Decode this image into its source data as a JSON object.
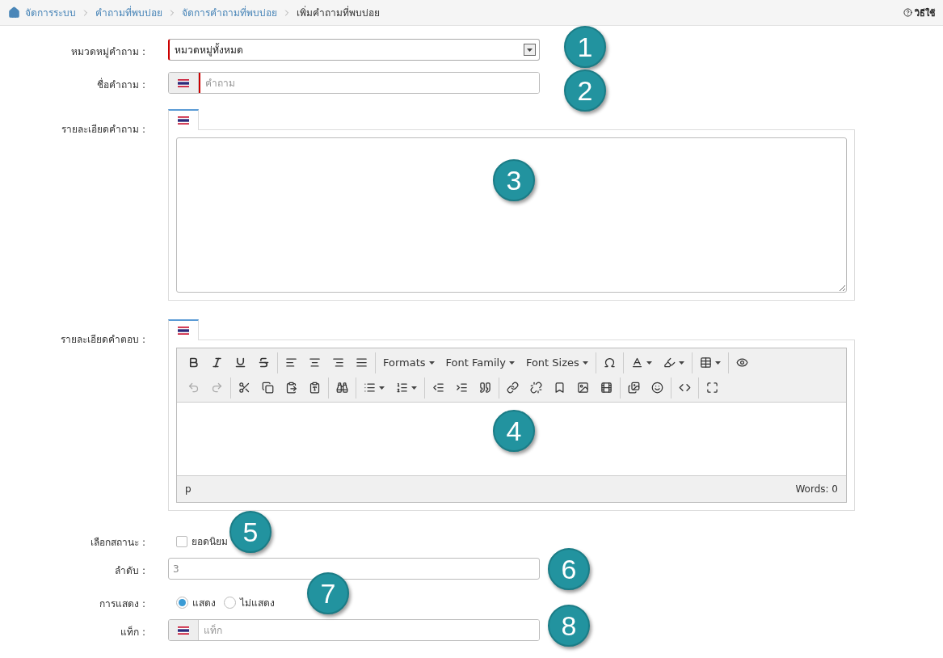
{
  "breadcrumb": [
    {
      "label": "จัดการระบบ",
      "current": false
    },
    {
      "label": "คำถามที่พบบ่อย",
      "current": false
    },
    {
      "label": "จัดการคำถามที่พบบ่อย",
      "current": false
    },
    {
      "label": "เพิ่มคำถามที่พบบ่อย",
      "current": true
    }
  ],
  "help": "วิธีใช้",
  "fields": [
    {
      "kind": "select",
      "label": "หมวดหมู่คำถาม :",
      "value": "หมวดหมู่ทั้งหมด",
      "required": true,
      "callout": "1"
    },
    {
      "kind": "flag-input",
      "label": "ชื่อคำถาม :",
      "placeholder": "คำถาม",
      "required": true,
      "callout": "2"
    },
    {
      "kind": "textarea",
      "label": "รายละเอียดคำถาม :",
      "callout": "3"
    },
    {
      "kind": "editor",
      "label": "รายละเอียดคำตอบ :",
      "callout": "4",
      "path": "p",
      "words": "Words: 0"
    },
    {
      "kind": "checkbox",
      "label": "เลือกสถานะ :",
      "option": "ยอดนิยม",
      "checked": false,
      "callout": "5"
    },
    {
      "kind": "input",
      "label": "ลำดับ :",
      "value": "3",
      "callout": "6"
    },
    {
      "kind": "radio",
      "label": "การแสดง :",
      "options": [
        {
          "label": "แสดง",
          "selected": true
        },
        {
          "label": "ไม่แสดง",
          "selected": false
        }
      ],
      "callout": "7"
    },
    {
      "kind": "flag-input",
      "label": "แท็ก :",
      "placeholder": "แท็ก",
      "required": false,
      "callout": "8"
    }
  ],
  "toolbar": [
    [
      [
        {
          "kind": "icon",
          "disabled": false
        },
        {
          "kind": "icon",
          "disabled": false
        },
        {
          "kind": "icon",
          "disabled": false
        },
        {
          "kind": "icon",
          "disabled": false
        }
      ],
      [
        {
          "kind": "icon",
          "disabled": false
        },
        {
          "kind": "icon",
          "disabled": false
        },
        {
          "kind": "icon",
          "disabled": false
        },
        {
          "kind": "icon",
          "disabled": false
        }
      ],
      [
        {
          "kind": "menu",
          "label": "Formats"
        },
        {
          "kind": "menu",
          "label": "Font Family"
        },
        {
          "kind": "menu",
          "label": "Font Sizes"
        }
      ],
      [
        {
          "kind": "icon",
          "disabled": false
        }
      ],
      [
        {
          "kind": "split",
          "disabled": false
        },
        {
          "kind": "split",
          "disabled": false
        }
      ],
      [
        {
          "kind": "split",
          "disabled": false
        }
      ],
      [
        {
          "kind": "icon",
          "disabled": false
        }
      ]
    ],
    [
      [
        {
          "kind": "icon",
          "disabled": true
        },
        {
          "kind": "icon",
          "disabled": true
        }
      ],
      [
        {
          "kind": "icon",
          "disabled": false
        },
        {
          "kind": "icon",
          "disabled": false
        },
        {
          "kind": "icon",
          "disabled": false
        },
        {
          "kind": "icon",
          "disabled": false
        }
      ],
      [
        {
          "kind": "icon",
          "disabled": false
        }
      ],
      [
        {
          "kind": "split",
          "disabled": false
        },
        {
          "kind": "split",
          "disabled": false
        }
      ],
      [
        {
          "kind": "icon",
          "disabled": false
        },
        {
          "kind": "icon",
          "disabled": false
        },
        {
          "kind": "icon",
          "disabled": false
        }
      ],
      [
        {
          "kind": "icon",
          "disabled": false
        },
        {
          "kind": "icon",
          "disabled": false
        },
        {
          "kind": "icon",
          "disabled": false
        },
        {
          "kind": "icon",
          "disabled": false
        },
        {
          "kind": "icon",
          "disabled": false
        }
      ],
      [
        {
          "kind": "icon",
          "disabled": false
        },
        {
          "kind": "icon",
          "disabled": false
        }
      ],
      [
        {
          "kind": "icon",
          "disabled": false
        }
      ],
      [
        {
          "kind": "icon",
          "disabled": false
        }
      ]
    ]
  ]
}
